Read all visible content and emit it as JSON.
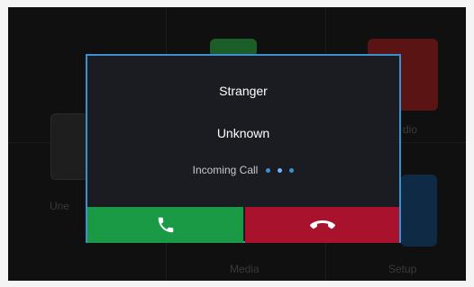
{
  "background_menu": {
    "labels": {
      "left_partial": "Une",
      "radio_partial": "dio",
      "media": "Media",
      "setup": "Setup"
    }
  },
  "call_dialog": {
    "caller_name": "Stranger",
    "caller_number": "Unknown",
    "status": "Incoming Call",
    "answer_icon": "phone-answer-icon",
    "decline_icon": "phone-hangup-icon",
    "colors": {
      "border": "#3c8fd0",
      "answer": "#1b9a45",
      "decline": "#a8122c",
      "indicator": "#3c8fd0"
    }
  }
}
